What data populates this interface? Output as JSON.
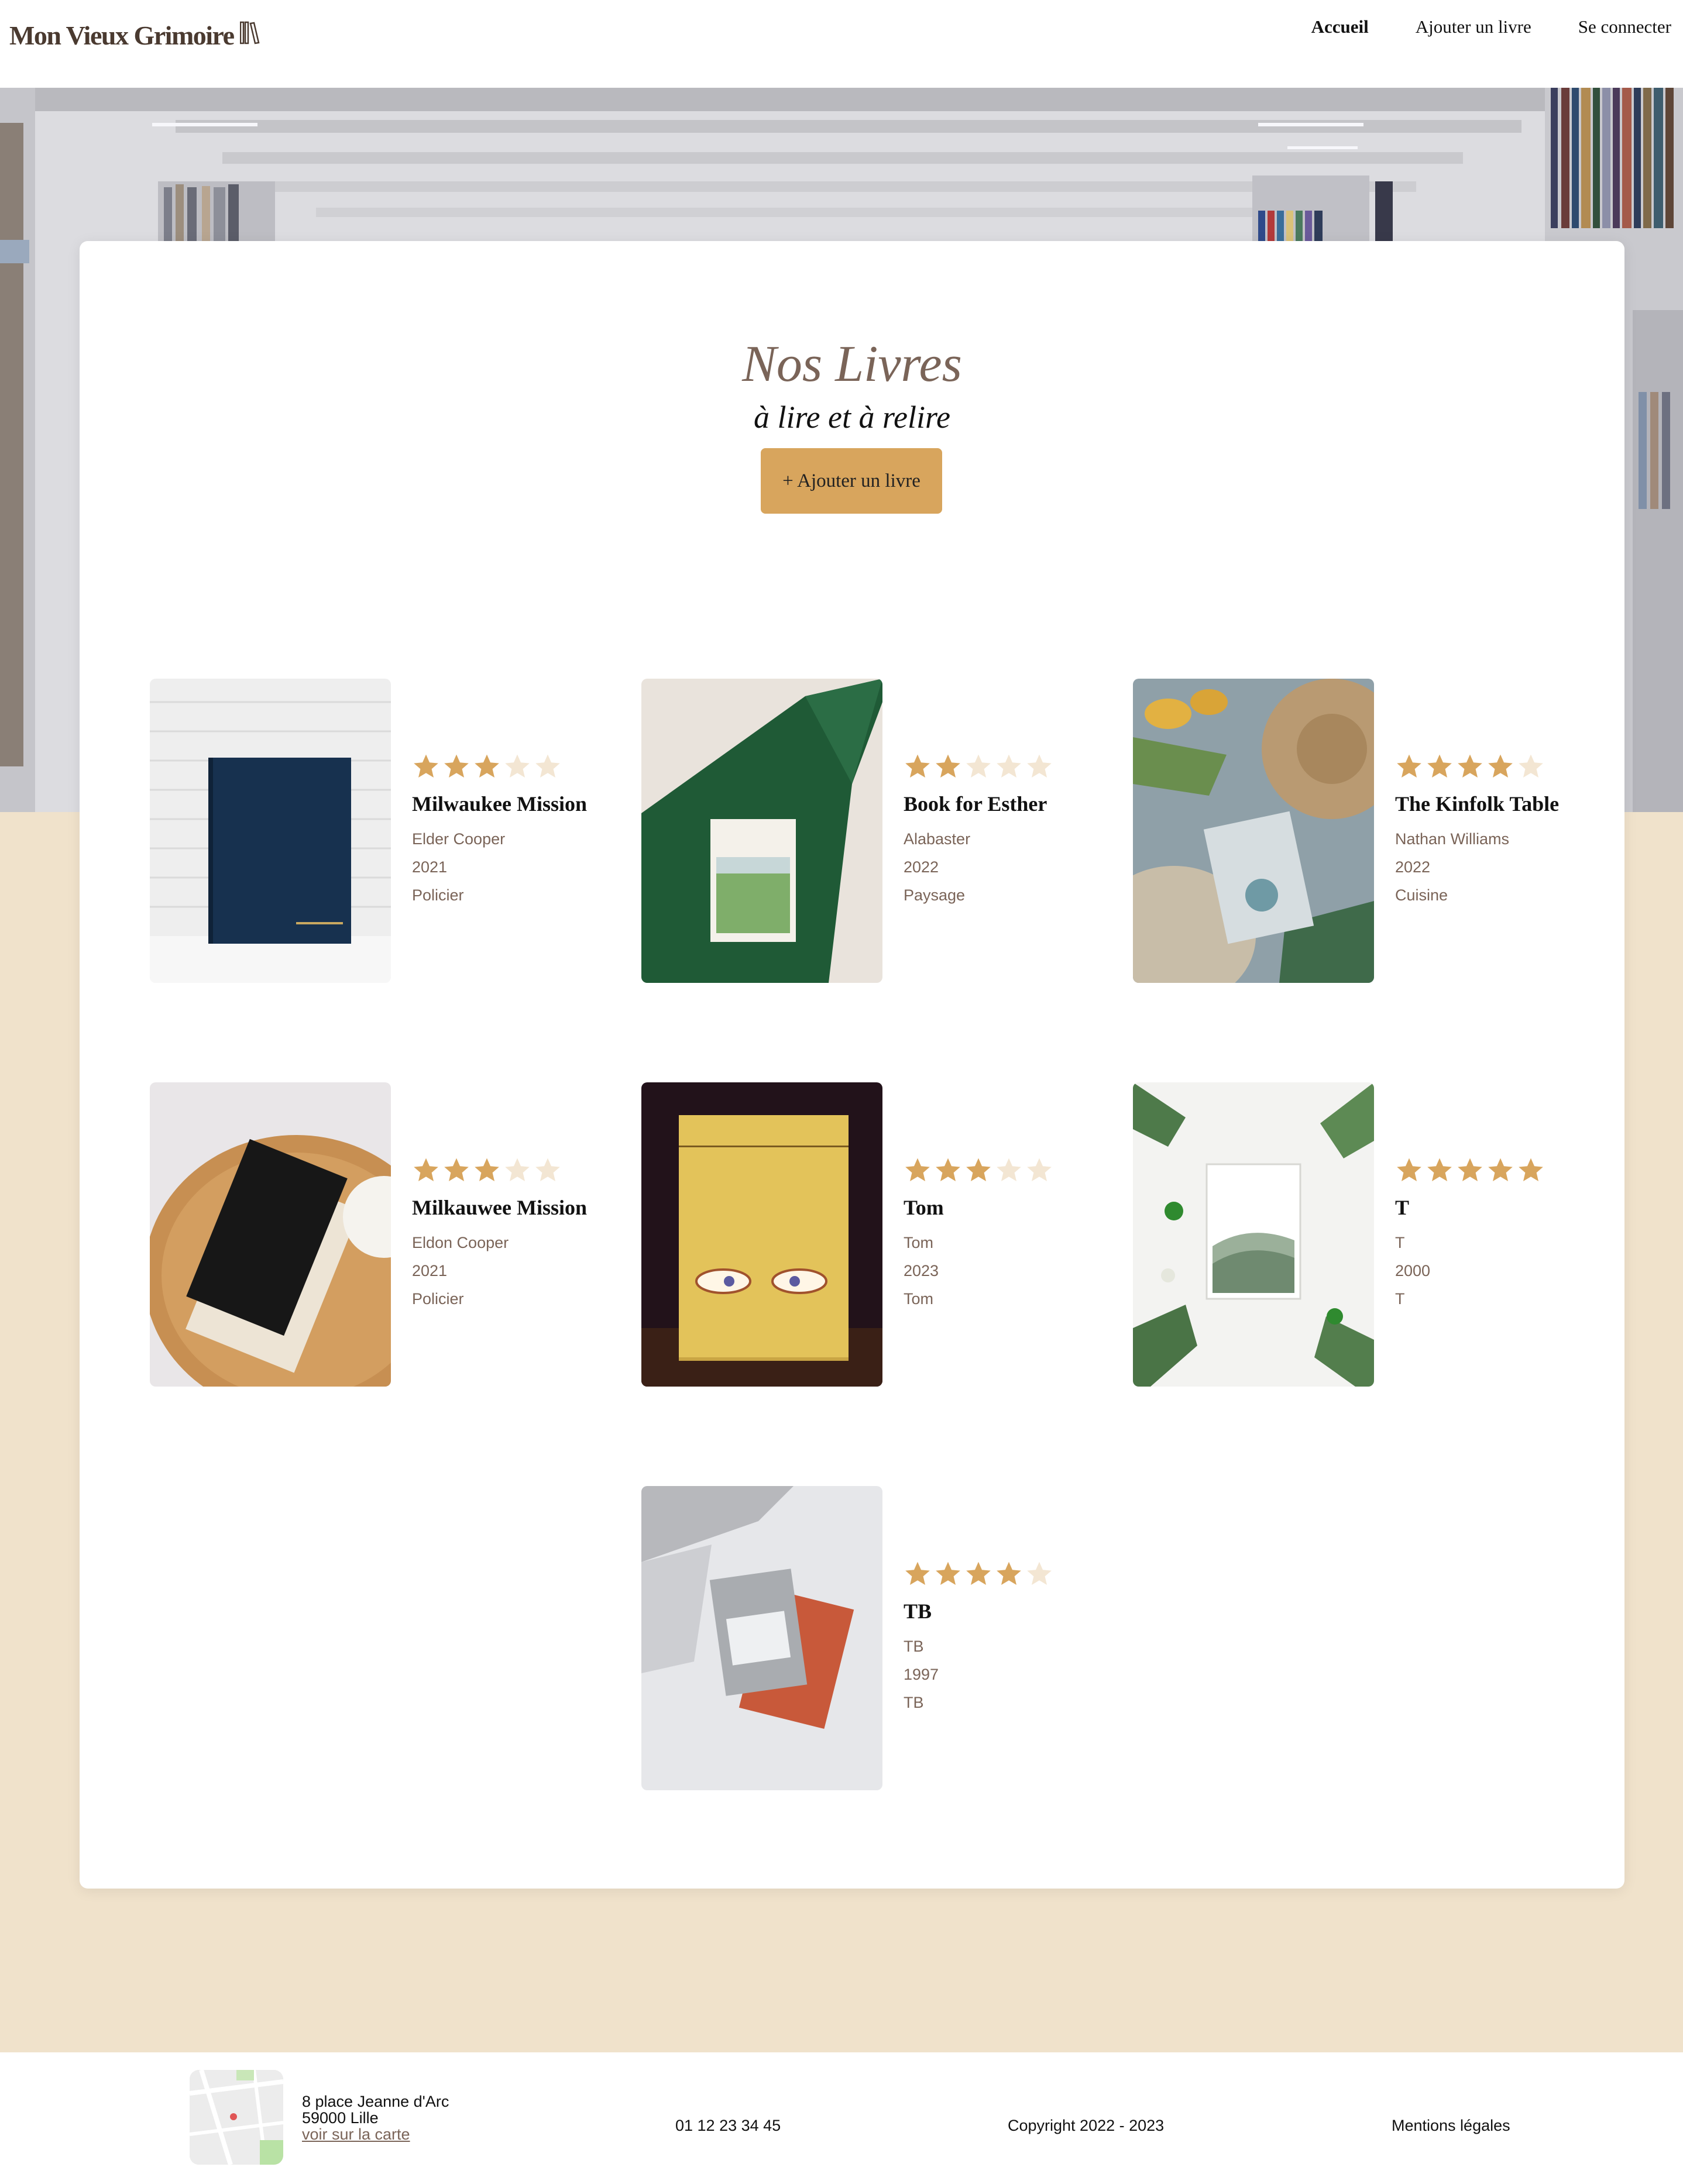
{
  "header": {
    "logo_text": "Mon Vieux Grimoire",
    "nav": [
      {
        "label": "Accueil",
        "active": true
      },
      {
        "label": "Ajouter un livre",
        "active": false
      },
      {
        "label": "Se connecter",
        "active": false
      }
    ]
  },
  "main": {
    "title": "Nos Livres",
    "subtitle": "à lire et à relire",
    "add_button_label": "+ Ajouter un livre",
    "books": [
      {
        "title": "Milwaukee Mission",
        "author": "Elder Cooper",
        "year": "2021",
        "genre": "Policier",
        "rating": 3
      },
      {
        "title": "Book for Esther",
        "author": "Alabaster",
        "year": "2022",
        "genre": "Paysage",
        "rating": 2
      },
      {
        "title": "The Kinfolk Table",
        "author": "Nathan Williams",
        "year": "2022",
        "genre": "Cuisine",
        "rating": 4
      },
      {
        "title": "Milkauwee Mission",
        "author": "Eldon Cooper",
        "year": "2021",
        "genre": "Policier",
        "rating": 3
      },
      {
        "title": "Tom",
        "author": "Tom",
        "year": "2023",
        "genre": "Tom",
        "rating": 3
      },
      {
        "title": "T",
        "author": "T",
        "year": "2000",
        "genre": "T",
        "rating": 5
      },
      {
        "title": "TB",
        "author": "TB",
        "year": "1997",
        "genre": "TB",
        "rating": 4
      }
    ]
  },
  "footer": {
    "address_line1": "8 place Jeanne d'Arc",
    "address_line2": "59000 Lille",
    "map_link": "voir sur la carte",
    "phone": "01 12 23 34 45",
    "copyright": "Copyright 2022 - 2023",
    "legal": "Mentions légales"
  },
  "colors": {
    "accent": "#d8a55d",
    "star_filled": "#d8a55d",
    "star_empty": "#f3e6d3",
    "page_background": "#f0e2cb",
    "meta_text": "#7a6458"
  }
}
